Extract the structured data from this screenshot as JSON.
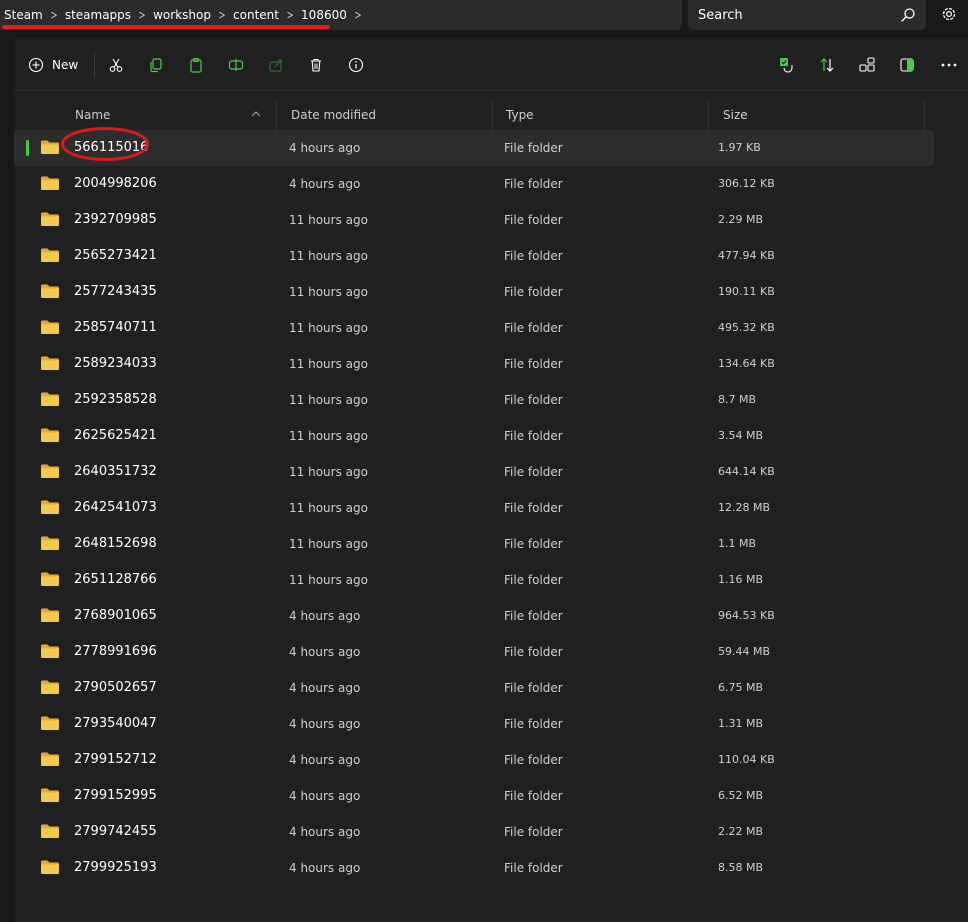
{
  "breadcrumb": [
    "Steam",
    "steamapps",
    "workshop",
    "content",
    "108600"
  ],
  "search": {
    "placeholder": "Search"
  },
  "toolbar": {
    "new_label": "New"
  },
  "columns": {
    "name": "Name",
    "date": "Date modified",
    "type": "Type",
    "size": "Size"
  },
  "colors": {
    "accent_selected": "#4cc94c",
    "folder": "#f2c14e",
    "annotation": "#e01818"
  },
  "files": [
    {
      "name": "566115016",
      "date": "4 hours ago",
      "type": "File folder",
      "size": "1.97 KB"
    },
    {
      "name": "2004998206",
      "date": "4 hours ago",
      "type": "File folder",
      "size": "306.12 KB"
    },
    {
      "name": "2392709985",
      "date": "11 hours ago",
      "type": "File folder",
      "size": "2.29 MB"
    },
    {
      "name": "2565273421",
      "date": "11 hours ago",
      "type": "File folder",
      "size": "477.94 KB"
    },
    {
      "name": "2577243435",
      "date": "11 hours ago",
      "type": "File folder",
      "size": "190.11 KB"
    },
    {
      "name": "2585740711",
      "date": "11 hours ago",
      "type": "File folder",
      "size": "495.32 KB"
    },
    {
      "name": "2589234033",
      "date": "11 hours ago",
      "type": "File folder",
      "size": "134.64 KB"
    },
    {
      "name": "2592358528",
      "date": "11 hours ago",
      "type": "File folder",
      "size": "8.7 MB"
    },
    {
      "name": "2625625421",
      "date": "11 hours ago",
      "type": "File folder",
      "size": "3.54 MB"
    },
    {
      "name": "2640351732",
      "date": "11 hours ago",
      "type": "File folder",
      "size": "644.14 KB"
    },
    {
      "name": "2642541073",
      "date": "11 hours ago",
      "type": "File folder",
      "size": "12.28 MB"
    },
    {
      "name": "2648152698",
      "date": "11 hours ago",
      "type": "File folder",
      "size": "1.1 MB"
    },
    {
      "name": "2651128766",
      "date": "11 hours ago",
      "type": "File folder",
      "size": "1.16 MB"
    },
    {
      "name": "2768901065",
      "date": "4 hours ago",
      "type": "File folder",
      "size": "964.53 KB"
    },
    {
      "name": "2778991696",
      "date": "4 hours ago",
      "type": "File folder",
      "size": "59.44 MB"
    },
    {
      "name": "2790502657",
      "date": "4 hours ago",
      "type": "File folder",
      "size": "6.75 MB"
    },
    {
      "name": "2793540047",
      "date": "4 hours ago",
      "type": "File folder",
      "size": "1.31 MB"
    },
    {
      "name": "2799152712",
      "date": "4 hours ago",
      "type": "File folder",
      "size": "110.04 KB"
    },
    {
      "name": "2799152995",
      "date": "4 hours ago",
      "type": "File folder",
      "size": "6.52 MB"
    },
    {
      "name": "2799742455",
      "date": "4 hours ago",
      "type": "File folder",
      "size": "2.22 MB"
    },
    {
      "name": "2799925193",
      "date": "4 hours ago",
      "type": "File folder",
      "size": "8.58 MB"
    }
  ]
}
